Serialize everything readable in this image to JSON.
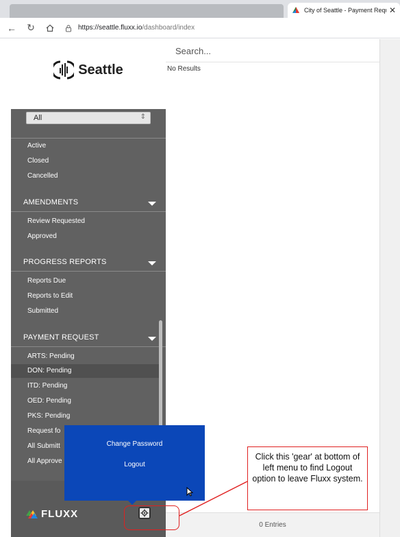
{
  "browser": {
    "tab_title": "City of Seattle - Payment Reques",
    "url_domain": "https://seattle.fluxx.io",
    "url_path": "/dashboard/index"
  },
  "sidebar": {
    "logo_text": "Seattle",
    "filter_value": "All",
    "status_items": [
      "Active",
      "Closed",
      "Cancelled"
    ],
    "sections": [
      {
        "title": "AMENDMENTS",
        "items": [
          "Review Requested",
          "Approved"
        ]
      },
      {
        "title": "PROGRESS REPORTS",
        "items": [
          "Reports Due",
          "Reports to Edit",
          "Submitted"
        ]
      },
      {
        "title": "PAYMENT REQUEST",
        "items": [
          "ARTS: Pending",
          "DON: Pending",
          "ITD: Pending",
          "OED: Pending",
          "PKS: Pending",
          "Request fo",
          "All Submitt",
          "All Approve"
        ]
      }
    ],
    "selected_item": "DON: Pending",
    "footer_logo": "FLUXX"
  },
  "popup": {
    "change_password": "Change Password",
    "logout": "Logout"
  },
  "main": {
    "search_placeholder": "Search...",
    "no_results": "No Results",
    "entries": "0 Entries"
  },
  "annotation": {
    "text": "Click this 'gear' at bottom of left menu to find Logout option to leave Fluxx system."
  },
  "colors": {
    "sidebar_bg": "#616161",
    "popup_bg": "#0b47b8",
    "annotation_red": "#e02020"
  }
}
